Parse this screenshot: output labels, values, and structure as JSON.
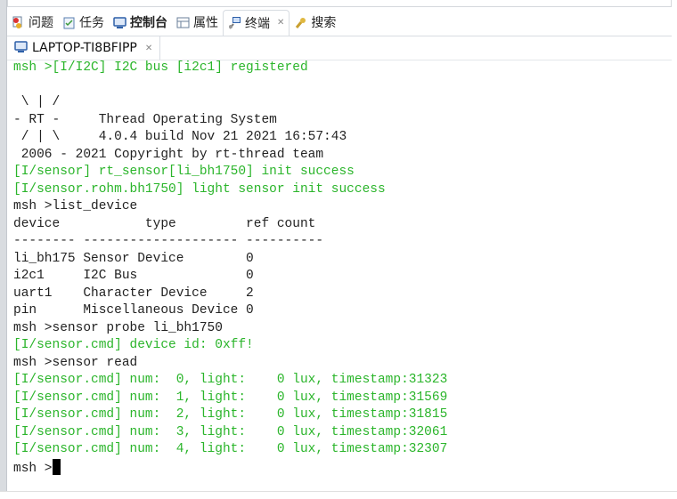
{
  "colors": {
    "output_green": "#2bb52b",
    "text": "#222222",
    "cursor": "#000000"
  },
  "view_tabs": [
    {
      "label": "问题",
      "icon": "problems-icon",
      "active": false
    },
    {
      "label": "任务",
      "icon": "tasks-icon",
      "active": false
    },
    {
      "label": "控制台",
      "icon": "console-icon",
      "active": false,
      "bold": true
    },
    {
      "label": "属性",
      "icon": "properties-icon",
      "active": false
    },
    {
      "label": "终端",
      "icon": "terminal-icon",
      "active": true,
      "closable": true
    },
    {
      "label": "搜索",
      "icon": "search-icon",
      "active": false
    }
  ],
  "terminal_tab": {
    "label": "LAPTOP-TI8BFIPP",
    "icon": "monitor-icon",
    "closable": true
  },
  "terminal": {
    "lines": [
      {
        "text": "msh >[I/I2C] I2C bus [i2c1] registered",
        "color": "green"
      },
      {
        "text": "",
        "color": "default"
      },
      {
        "text": " \\ | /",
        "color": "default"
      },
      {
        "text": "- RT -     Thread Operating System",
        "color": "default"
      },
      {
        "text": " / | \\     4.0.4 build Nov 21 2021 16:57:43",
        "color": "default"
      },
      {
        "text": " 2006 - 2021 Copyright by rt-thread team",
        "color": "default"
      },
      {
        "text": "[I/sensor] rt_sensor[li_bh1750] init success",
        "color": "green"
      },
      {
        "text": "[I/sensor.rohm.bh1750] light sensor init success",
        "color": "green"
      },
      {
        "text": "msh >list_device",
        "color": "default"
      },
      {
        "text": "device           type         ref count",
        "color": "default"
      },
      {
        "text": "-------- -------------------- ----------",
        "color": "default"
      },
      {
        "text": "li_bh175 Sensor Device        0",
        "color": "default"
      },
      {
        "text": "i2c1     I2C Bus              0",
        "color": "default"
      },
      {
        "text": "uart1    Character Device     2",
        "color": "default"
      },
      {
        "text": "pin      Miscellaneous Device 0",
        "color": "default"
      },
      {
        "text": "msh >sensor probe li_bh1750",
        "color": "default"
      },
      {
        "text": "[I/sensor.cmd] device id: 0xff!",
        "color": "green"
      },
      {
        "text": "msh >sensor read",
        "color": "default"
      },
      {
        "text": "[I/sensor.cmd] num:  0, light:    0 lux, timestamp:31323",
        "color": "green"
      },
      {
        "text": "[I/sensor.cmd] num:  1, light:    0 lux, timestamp:31569",
        "color": "green"
      },
      {
        "text": "[I/sensor.cmd] num:  2, light:    0 lux, timestamp:31815",
        "color": "green"
      },
      {
        "text": "[I/sensor.cmd] num:  3, light:    0 lux, timestamp:32061",
        "color": "green"
      },
      {
        "text": "[I/sensor.cmd] num:  4, light:    0 lux, timestamp:32307",
        "color": "green"
      }
    ],
    "prompt": "msh >"
  }
}
